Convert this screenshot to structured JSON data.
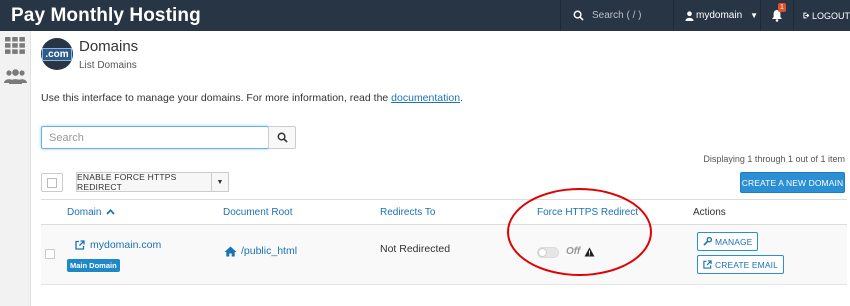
{
  "topbar": {
    "brand": "Pay Monthly Hosting",
    "search_placeholder": "Search ( / )",
    "user": "mydomain",
    "notifications_count": "1",
    "logout": "LOGOUT"
  },
  "header": {
    "title": "Domains",
    "subtitle": "List Domains",
    "icon_text": ".com"
  },
  "intro": {
    "text": "Use this interface to manage your domains. For more information, read the ",
    "link": "documentation",
    "after": "."
  },
  "search": {
    "placeholder": "Search"
  },
  "displaying": "Displaying 1 through 1 out of 1 item",
  "toolbar": {
    "enable_label": "ENABLE FORCE HTTPS REDIRECT",
    "create_label": "CREATE A NEW DOMAIN"
  },
  "table": {
    "columns": [
      "Domain",
      "Document Root",
      "Redirects To",
      "Force HTTPS Redirect",
      "Actions"
    ],
    "rows": [
      {
        "domain": "mydomain.com",
        "badge": "Main Domain",
        "document_root": "/public_html",
        "redirects_to": "Not Redirected",
        "force_https": "Off",
        "actions": [
          "MANAGE",
          "CREATE EMAIL"
        ]
      }
    ]
  },
  "colors": {
    "topbar": "#283544",
    "link": "#1a73b5",
    "primary_button": "#2b8fd6",
    "annotation": "#e00000"
  }
}
